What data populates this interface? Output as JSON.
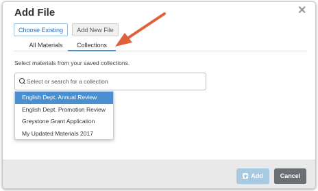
{
  "dialog": {
    "title": "Add File",
    "close_icon": "close-icon"
  },
  "mode_tabs": [
    {
      "label": "Choose Existing",
      "active": true
    },
    {
      "label": "Add New File",
      "active": false
    }
  ],
  "sub_tabs": [
    {
      "label": "All Materials",
      "active": false
    },
    {
      "label": "Collections",
      "active": true
    }
  ],
  "instructions": "Select materials from your saved collections.",
  "collection_select": {
    "placeholder": "Select or search for a collection",
    "icon": "search-icon",
    "options": [
      {
        "label": "English Dept. Annual Review",
        "highlighted": true
      },
      {
        "label": "English Dept. Promotion Review",
        "highlighted": false
      },
      {
        "label": "Greystone Grant Application",
        "highlighted": false
      },
      {
        "label": "My Updated Materials 2017",
        "highlighted": false
      }
    ]
  },
  "footer": {
    "add_label": "Add",
    "add_icon": "plus-square-icon",
    "cancel_label": "Cancel"
  },
  "colors": {
    "accent": "#4a8fd0",
    "annotation_arrow": "#e0603a",
    "add_button_disabled": "#a7c9e2",
    "cancel_button": "#6b6e73"
  }
}
